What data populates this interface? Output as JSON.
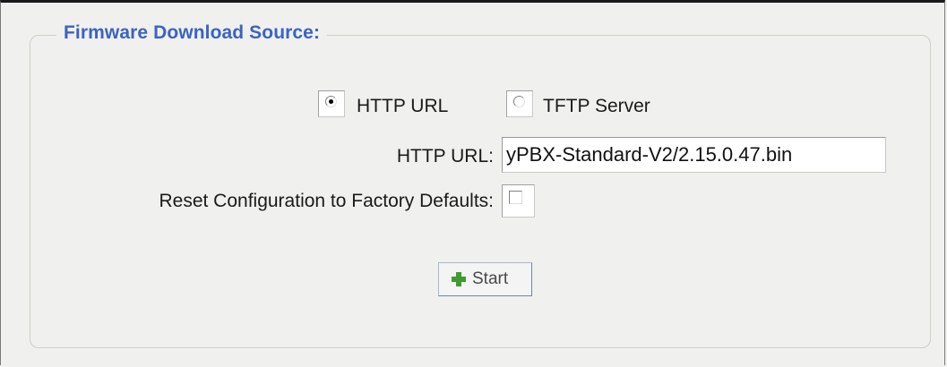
{
  "section": {
    "title": "Firmware Download Source:"
  },
  "source_options": [
    {
      "label": "HTTP URL",
      "selected": true
    },
    {
      "label": "TFTP Server",
      "selected": false
    }
  ],
  "http_url": {
    "label": "HTTP URL:",
    "value": "yPBX-Standard-V2/2.15.0.47.bin"
  },
  "reset_config": {
    "label": "Reset Configuration to Factory Defaults:",
    "checked": false
  },
  "start_button": {
    "label": "Start",
    "icon": "plus-icon",
    "icon_color": "#3f9b2f"
  },
  "colors": {
    "accent": "#3a63c2"
  }
}
